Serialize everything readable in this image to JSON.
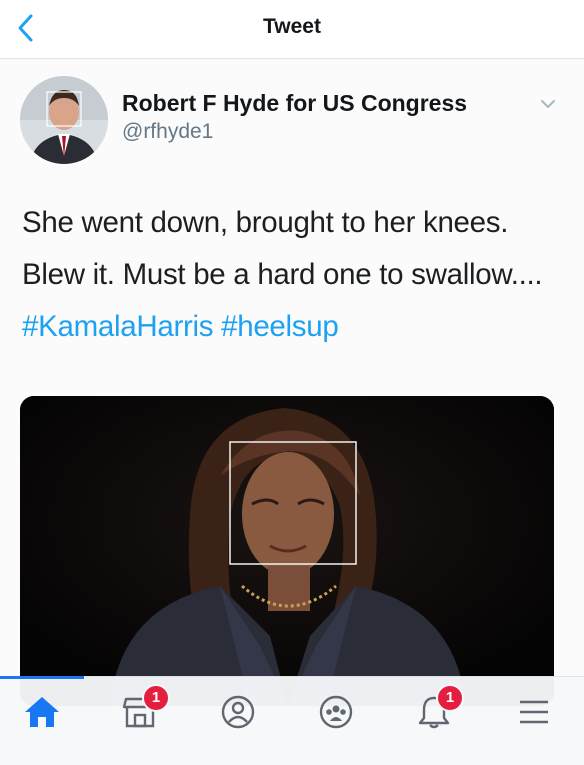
{
  "header": {
    "title": "Tweet",
    "back_icon": "chevron-left-icon"
  },
  "tweet": {
    "author_name": "Robert F Hyde for US Congress",
    "author_handle": "@rfhyde1",
    "text_plain": "She went down, brought to her knees. Blew it. Must be a hard one to swallow....",
    "hashtags": [
      "#KamalaHarris",
      "#heelsup"
    ]
  },
  "bottom_nav": {
    "items": [
      {
        "icon": "home-icon",
        "badge": ""
      },
      {
        "icon": "marketplace-icon",
        "badge": "1"
      },
      {
        "icon": "profile-icon",
        "badge": ""
      },
      {
        "icon": "groups-icon",
        "badge": ""
      },
      {
        "icon": "notifications-bell-icon",
        "badge": "1"
      },
      {
        "icon": "menu-icon",
        "badge": ""
      }
    ]
  },
  "colors": {
    "accent": "#1da1f2",
    "facebook_blue": "#1877f2",
    "badge_red": "#e41e3f"
  }
}
